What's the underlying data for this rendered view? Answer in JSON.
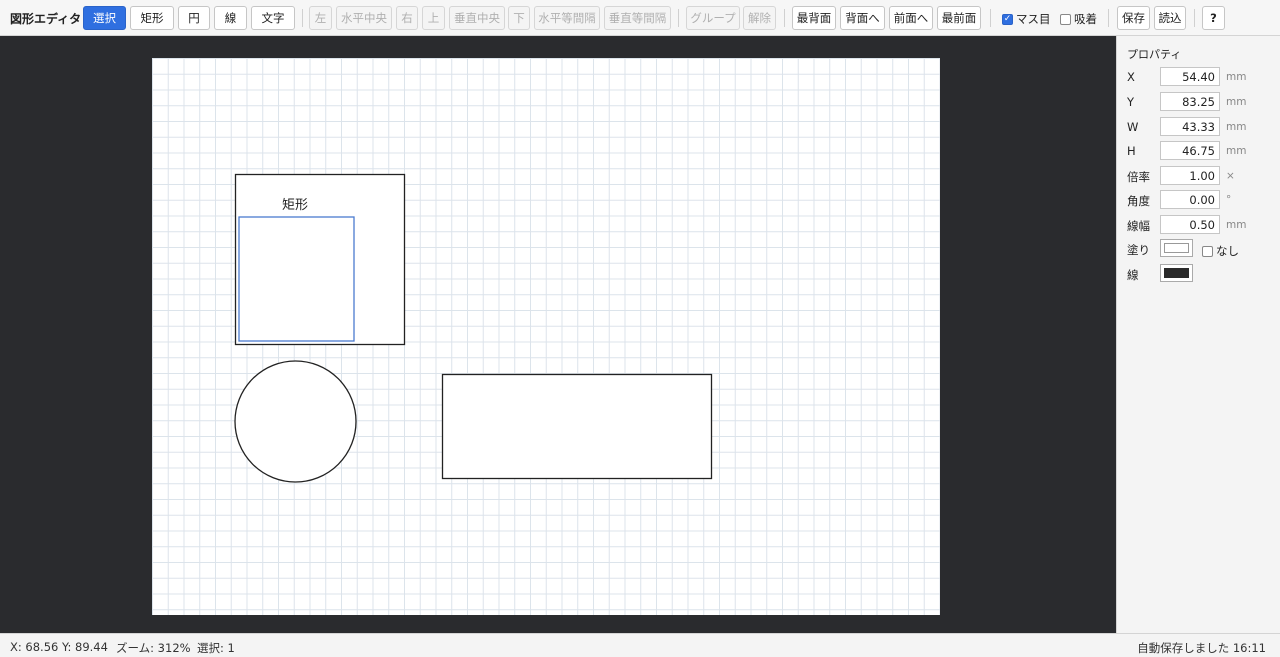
{
  "app": {
    "title": "図形エディタ"
  },
  "toolbar": {
    "tools": {
      "select": "選択",
      "rect": "矩形",
      "circle": "円",
      "line": "線",
      "text": "文字"
    },
    "align": {
      "left": "左",
      "h_center": "水平中央",
      "right": "右",
      "top": "上",
      "v_center": "垂直中央",
      "bottom": "下",
      "h_distribute": "水平等間隔",
      "v_distribute": "垂直等間隔"
    },
    "group": {
      "group": "グループ",
      "ungroup": "解除"
    },
    "order": {
      "to_back": "最背面",
      "backward": "背面へ",
      "forward": "前面へ",
      "to_front": "最前面"
    },
    "grid": {
      "label": "マス目",
      "checked": true
    },
    "snap": {
      "label": "吸着",
      "checked": false
    },
    "save": "保存",
    "load": "読込",
    "help": "?"
  },
  "canvas": {
    "text_label": "矩形",
    "selection_color": "#4a7bd0",
    "stroke_color": "#222222"
  },
  "properties": {
    "title": "プロパティ",
    "x": {
      "label": "X",
      "value": "54.40",
      "unit": "mm"
    },
    "y": {
      "label": "Y",
      "value": "83.25",
      "unit": "mm"
    },
    "w": {
      "label": "W",
      "value": "43.33",
      "unit": "mm"
    },
    "h": {
      "label": "H",
      "value": "46.75",
      "unit": "mm"
    },
    "scale": {
      "label": "倍率",
      "value": "1.00",
      "unit": "×"
    },
    "angle": {
      "label": "角度",
      "value": "0.00",
      "unit": "°"
    },
    "stroke_width": {
      "label": "線幅",
      "value": "0.50",
      "unit": "mm"
    },
    "fill": {
      "label": "塗り",
      "color": "#ffffff",
      "none_label": "なし",
      "none_checked": false
    },
    "stroke": {
      "label": "線",
      "color": "#2a2a2a"
    }
  },
  "status": {
    "cursor": "X: 68.56 Y: 89.44",
    "zoom": "ズーム: 312%",
    "selection": "選択: 1",
    "autosave": "自動保存しました 16:11"
  }
}
